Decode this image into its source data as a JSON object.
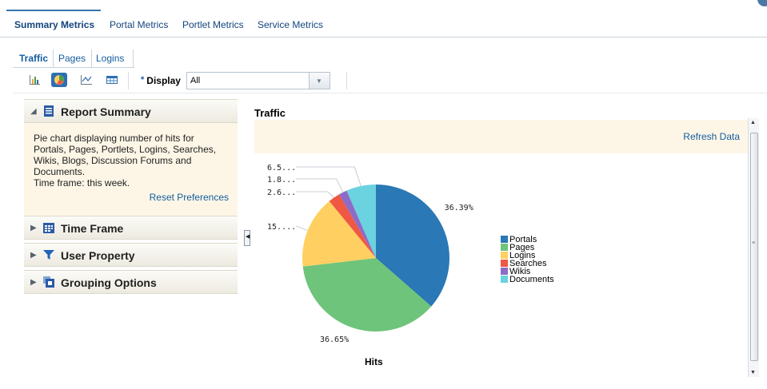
{
  "top_tabs": [
    "Summary Metrics",
    "Portal Metrics",
    "Portlet Metrics",
    "Service Metrics"
  ],
  "sub_tabs": [
    "Traffic",
    "Pages",
    "Logins"
  ],
  "toolbar": {
    "icons": [
      "bar-chart-icon",
      "pie-chart-icon",
      "line-chart-icon",
      "table-icon"
    ],
    "display_required": "*",
    "display_label": "Display",
    "display_value": "All"
  },
  "left_panel": {
    "report_summary": {
      "title": "Report Summary",
      "text": "Pie chart displaying number of hits for\nPortals, Pages, Portlets, Logins, Searches,\nWikis, Blogs, Discussion Forums and\nDocuments.\nTime frame: this week.",
      "reset_link": "Reset Preferences"
    },
    "time_frame": "Time Frame",
    "user_property": "User Property",
    "grouping_options": "Grouping Options"
  },
  "chart_panel": {
    "title": "Traffic",
    "refresh": "Refresh Data"
  },
  "chart_data": {
    "type": "pie",
    "xlabel": "Hits",
    "slice_order": [
      "Portals",
      "Pages",
      "Logins",
      "Searches",
      "Wikis",
      "Documents"
    ],
    "labels": [
      "36.39%",
      "36.65%",
      "15....",
      "2.6...",
      "1.8...",
      "6.5..."
    ],
    "values": [
      36.39,
      36.65,
      15.9,
      2.6,
      1.8,
      6.5
    ],
    "colors": [
      "#2a78b5",
      "#6ec47a",
      "#ffd061",
      "#ef5843",
      "#8d6cc7",
      "#6ad3df"
    ],
    "legend": [
      "Portals",
      "Pages",
      "Logins",
      "Searches",
      "Wikis",
      "Documents"
    ],
    "legend_placement": "right"
  }
}
